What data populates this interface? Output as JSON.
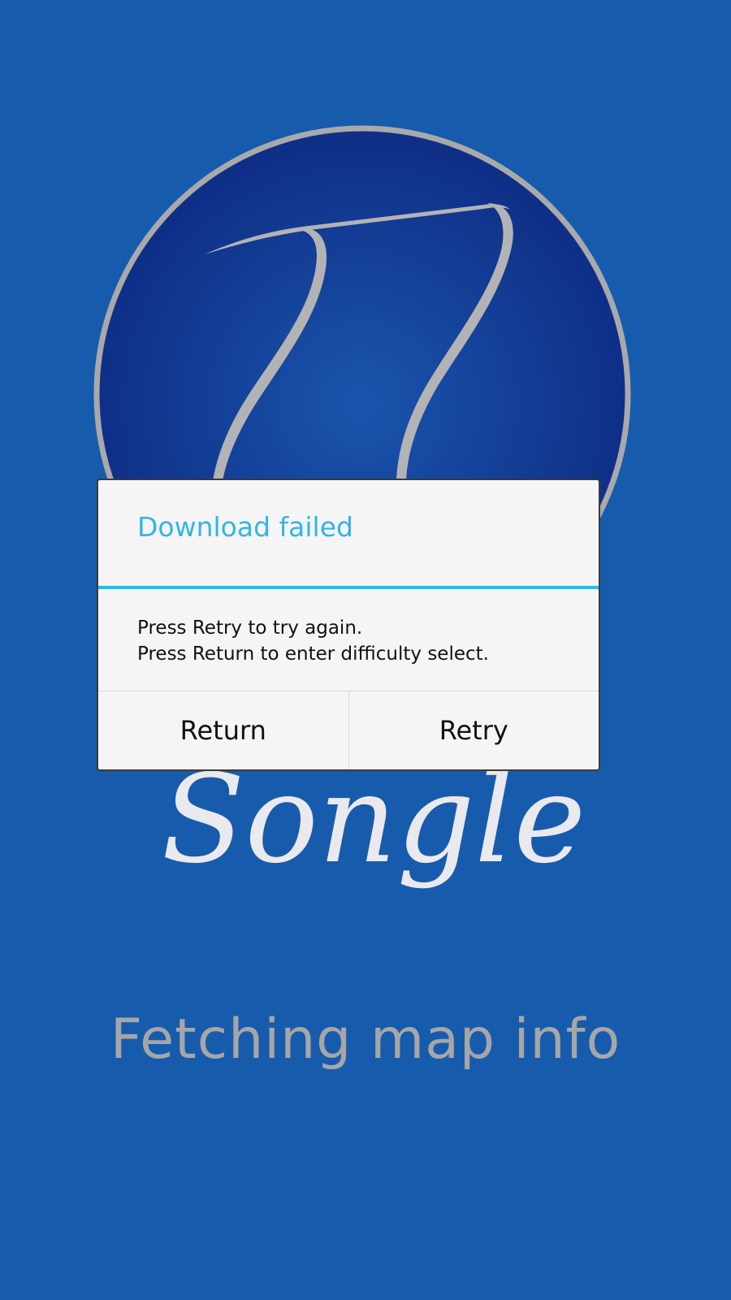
{
  "app": {
    "name": "Songle",
    "status_text": "Fetching map info"
  },
  "logo": {
    "icon": "music-note-logo-icon"
  },
  "dialog": {
    "title": "Download failed",
    "message_lines": [
      "Press Retry to try again.",
      "Press Return to enter difficulty select."
    ],
    "buttons": {
      "return_label": "Return",
      "retry_label": "Retry"
    }
  },
  "colors": {
    "background": "#175cac",
    "logo_circle_inner": "#1a55ad",
    "logo_circle_outer": "#0f2f87",
    "logo_ring": "#a9a9ab",
    "logo_note": "#b3b3b5",
    "wordmark": "#e9e9ee",
    "status_text": "#a6a6a8",
    "dialog_accent": "#33b5e5"
  }
}
